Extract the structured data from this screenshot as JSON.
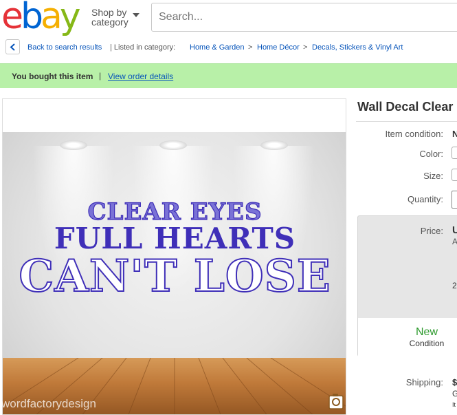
{
  "header": {
    "logo_letters": [
      "e",
      "b",
      "a",
      "y"
    ],
    "shop_by_line1": "Shop by",
    "shop_by_line2": "category",
    "search_placeholder": "Search..."
  },
  "breadcrumb": {
    "back_link": "Back to search results",
    "listed_in": "| Listed in category:",
    "items": [
      "Home & Garden",
      "Home Décor",
      "Decals, Stickers & Vinyl Art"
    ],
    "separator": ">"
  },
  "notice": {
    "bought_text": "You bought this item",
    "pipe": "|",
    "view_order": "View order details"
  },
  "image": {
    "decal_line1": "CLEAR EYES",
    "decal_line2": "FULL HEARTS",
    "decal_line3": "CAN'T LOSE",
    "watermark": "wordfactorydesign",
    "decal_color": "#3f2fb8"
  },
  "details": {
    "title": "Wall Decal Clear",
    "item_condition_label": "Item condition:",
    "item_condition_value": "N",
    "color_label": "Color:",
    "size_label": "Size:",
    "quantity_label": "Quantity:",
    "price_label": "Price:",
    "price_value": "U",
    "price_sub": "A",
    "price_num": "2",
    "condition_new": "New",
    "condition_label": "Condition",
    "shipping_label": "Shipping:",
    "shipping_value": "$",
    "shipping_sub1": "G",
    "shipping_sub2": "It"
  }
}
